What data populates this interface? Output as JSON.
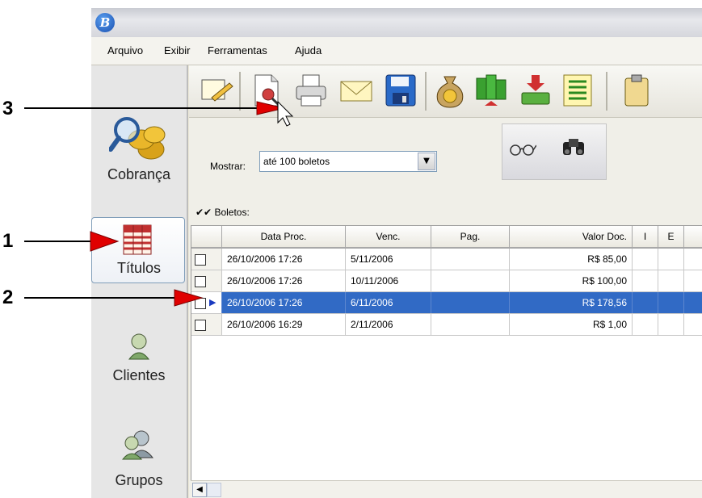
{
  "menu": [
    "Arquivo",
    "Exibir",
    "Ferramentas",
    "Ajuda"
  ],
  "sidebar": {
    "items": [
      {
        "label": "Cobrança",
        "icon": "coins-magnifier-icon"
      },
      {
        "label": "Títulos",
        "icon": "titles-ledger-icon",
        "selected": true
      },
      {
        "label": "Clientes",
        "icon": "client-icon"
      },
      {
        "label": "Grupos",
        "icon": "group-icon"
      }
    ]
  },
  "toolbar": {
    "buttons": [
      "edit-icon",
      "view-document-icon",
      "printer-icon",
      "email-icon",
      "save-disk-icon",
      "money-bag-icon",
      "register-icon",
      "download-icon",
      "list-icon"
    ]
  },
  "filter": {
    "mostrar_label": "Mostrar:",
    "mostrar_value": "até 100 boletos"
  },
  "grid": {
    "caption": "Boletos:",
    "columns": [
      "Data Proc.",
      "Venc.",
      "Pag.",
      "Valor Doc.",
      "I",
      "E"
    ],
    "rows": [
      {
        "data_proc": "26/10/2006 17:26",
        "venc": "5/11/2006",
        "pag": "",
        "valor": "R$ 85,00",
        "selected": false
      },
      {
        "data_proc": "26/10/2006 17:26",
        "venc": "10/11/2006",
        "pag": "",
        "valor": "R$ 100,00",
        "selected": false
      },
      {
        "data_proc": "26/10/2006 17:26",
        "venc": "6/11/2006",
        "pag": "",
        "valor": "R$ 178,56",
        "selected": true
      },
      {
        "data_proc": "26/10/2006 16:29",
        "venc": "2/11/2006",
        "pag": "",
        "valor": "R$ 1,00",
        "selected": false
      }
    ]
  },
  "annotations": [
    "1",
    "2",
    "3"
  ],
  "colors": {
    "selection": "#316ac5",
    "arrow": "#e00000"
  }
}
